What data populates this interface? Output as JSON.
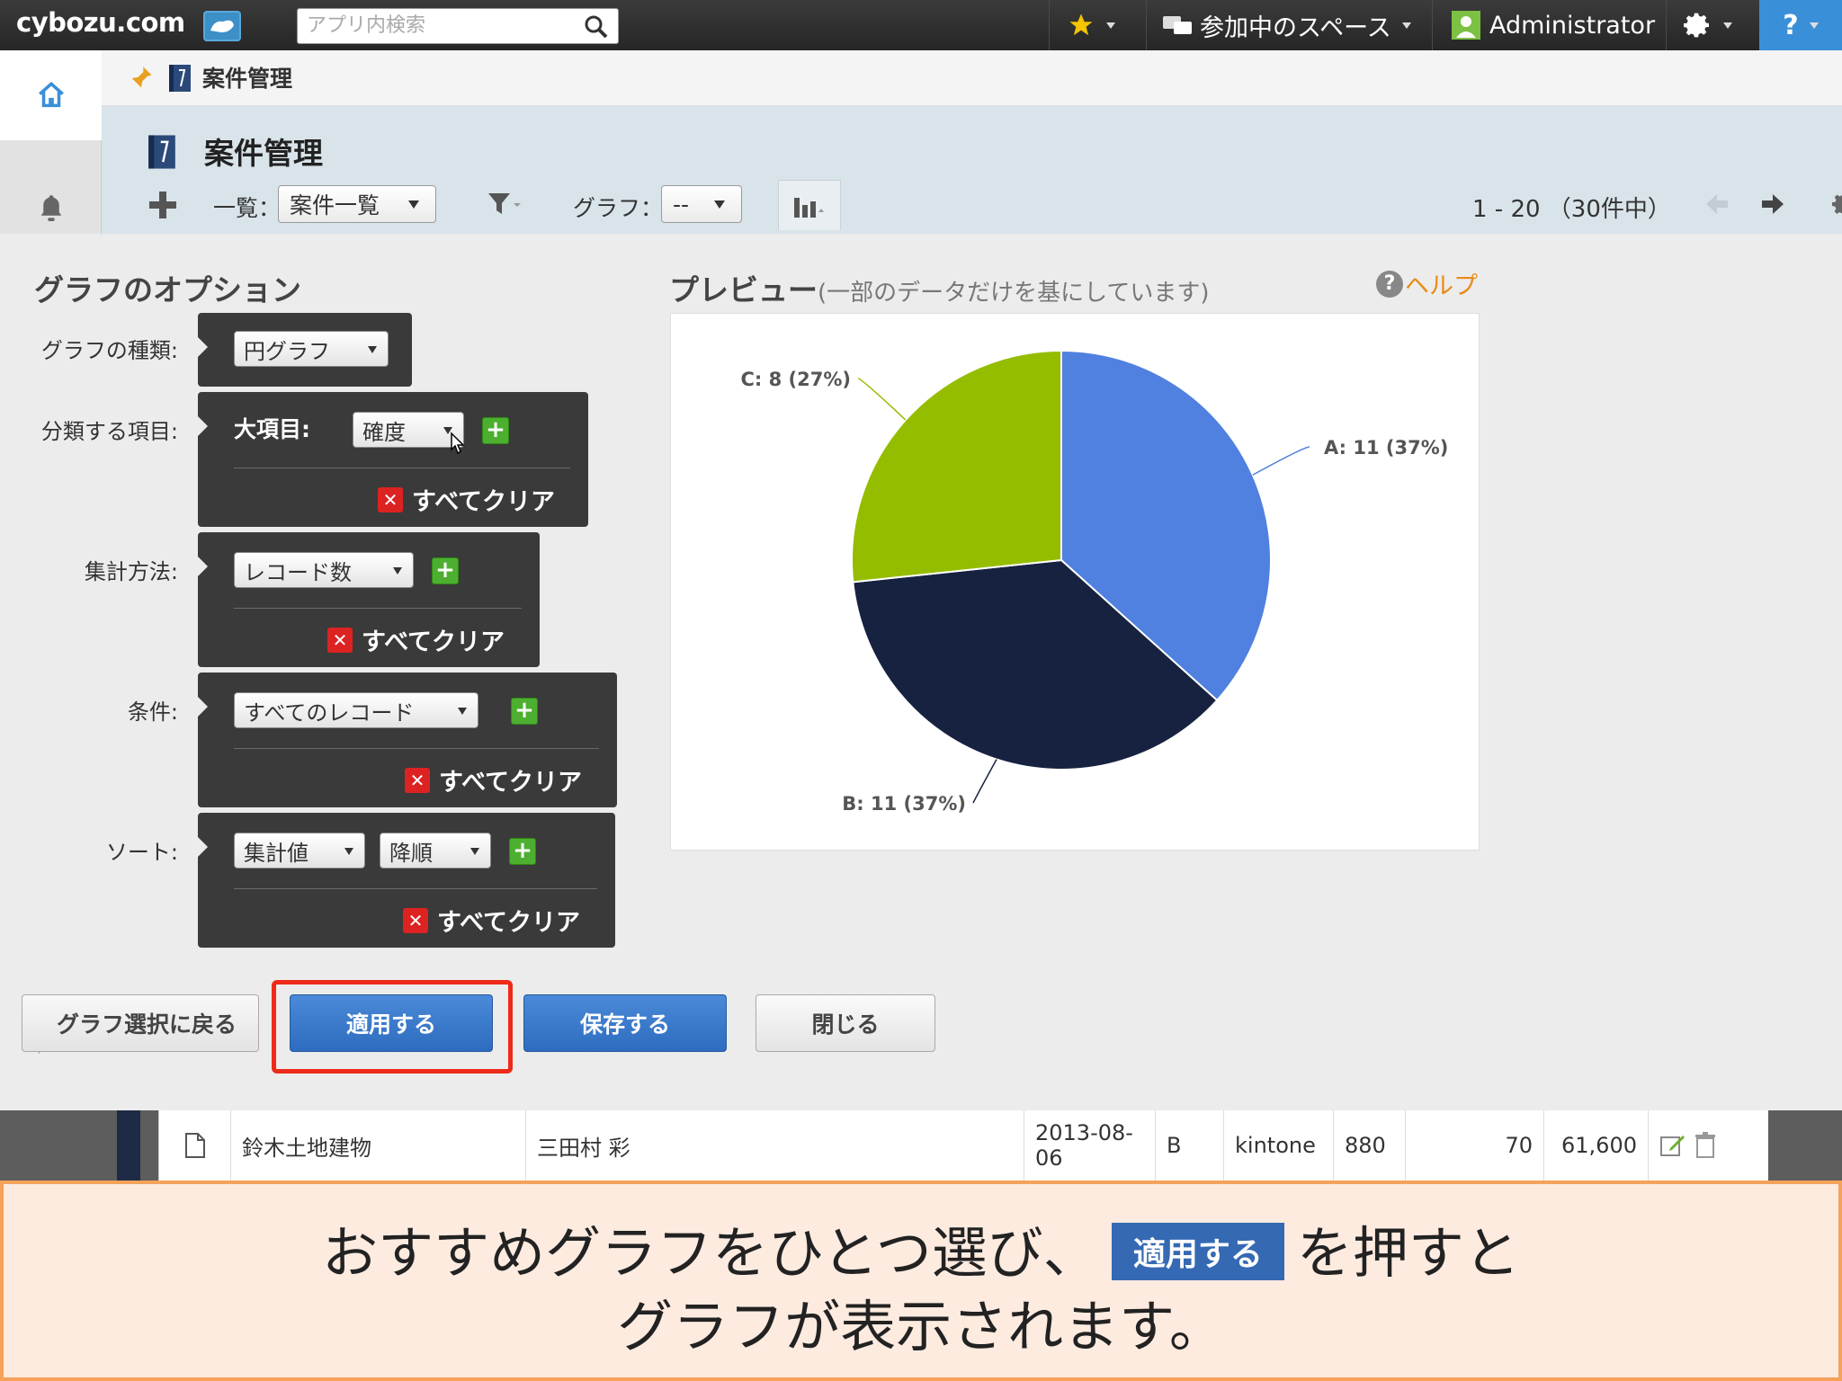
{
  "topbar": {
    "logo": "cybozu.com",
    "search_placeholder": "アプリ内検索",
    "spaces_label": "参加中のスペース",
    "user_label": "Administrator",
    "help_label": "?"
  },
  "breadcrumb": {
    "app_name": "案件管理"
  },
  "app_header": {
    "title": "案件管理",
    "view_label": "一覧：",
    "view_value": "案件一覧",
    "graph_label": "グラフ：",
    "graph_value": "--",
    "pager": "1 - 20 （30件中）"
  },
  "options": {
    "title": "グラフのオプション",
    "chart_type_label": "グラフの種類:",
    "chart_type_value": "円グラフ",
    "group_label": "分類する項目:",
    "group_inner_label": "大項目:",
    "group_value": "確度",
    "agg_label": "集計方法:",
    "agg_value": "レコード数",
    "cond_label": "条件:",
    "cond_value": "すべてのレコード",
    "sort_label": "ソート:",
    "sort_value1": "集計値",
    "sort_value2": "降順",
    "clear_all": "すべてクリア"
  },
  "preview": {
    "title": "プレビュー",
    "subtitle": "(一部のデータだけを基にしています)",
    "help": "ヘルプ"
  },
  "chart_data": {
    "type": "pie",
    "slices": [
      {
        "label": "A: 11 (37%)",
        "value": 11,
        "color": "#5080e0"
      },
      {
        "label": "B: 11 (37%)",
        "value": 11,
        "color": "#172240"
      },
      {
        "label": "C: 8 (27%)",
        "value": 8,
        "color": "#95bd00"
      }
    ]
  },
  "buttons": {
    "back": "グラフ選択に戻る",
    "apply": "適用する",
    "save": "保存する",
    "close": "閉じる"
  },
  "record_row": {
    "company": "鈴木土地建物",
    "person": "三田村 彩",
    "date": "2013-08-06",
    "rank": "B",
    "product": "kintone",
    "price": "880",
    "qty": "70",
    "total": "61,600"
  },
  "caption": {
    "line1_before": "おすすめグラフをひとつ選び、",
    "line1_button": "適用する",
    "line1_after": "を押すと",
    "line2": "グラフが表示されます。"
  }
}
